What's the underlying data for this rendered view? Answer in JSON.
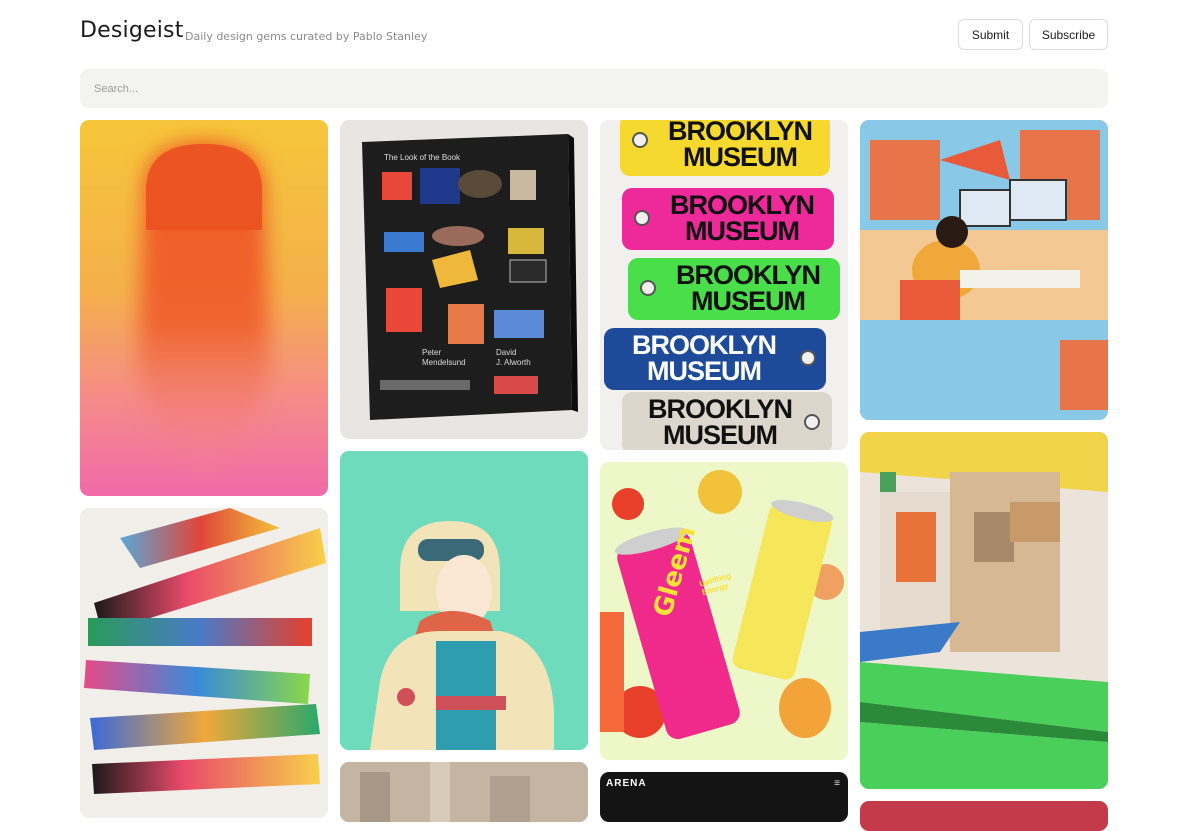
{
  "header": {
    "logo": "Desigeist",
    "tagline": "Daily design gems curated by Pablo Stanley",
    "submit_label": "Submit",
    "subscribe_label": "Subscribe"
  },
  "search": {
    "placeholder": "Search..."
  },
  "gallery": {
    "book": {
      "title": "The Look of the Book",
      "author1": "Peter\nMendelsund",
      "author2": "David\nJ. Alworth"
    },
    "keychain": {
      "line1": "BROOKLYN",
      "line2": "MUSEUM"
    },
    "arena": {
      "logo": "ARENA"
    },
    "cans": {
      "brand": "Gleem",
      "sub": "Uplifting Energy"
    }
  },
  "colors": {
    "search_bg": "#f3f3ef",
    "button_border": "#dcdcdc"
  }
}
